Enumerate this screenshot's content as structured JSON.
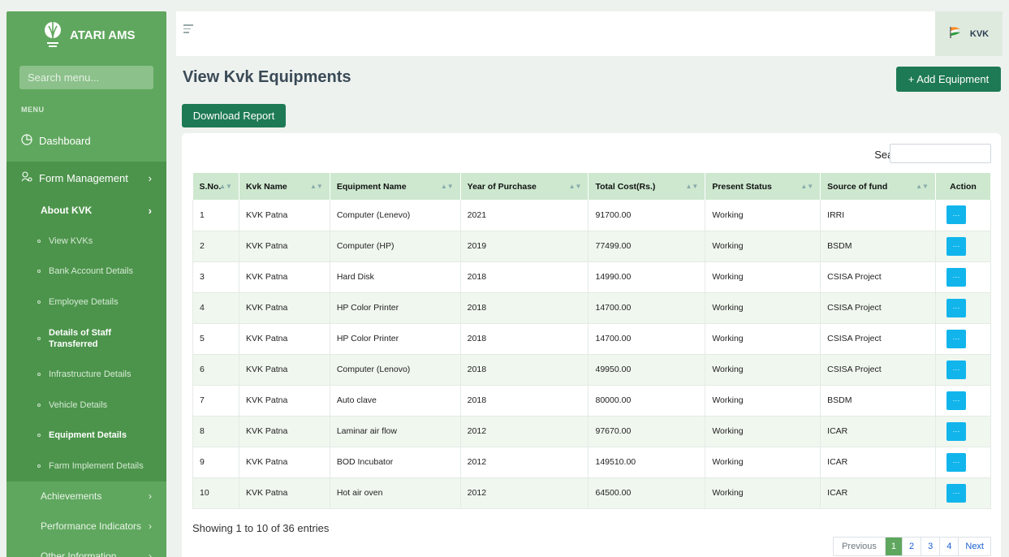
{
  "sidebar": {
    "brand": "ATARI AMS",
    "search_placeholder": "Search menu...",
    "menu_heading": "MENU",
    "dashboard": "Dashboard",
    "form_management": "Form Management",
    "about_kvk": "About KVK",
    "sub_items": [
      "View KVKs",
      "Bank Account Details",
      "Employee Details",
      "Details of Staff Transferred",
      "Infrastructure Details",
      "Vehicle Details",
      "Equipment Details",
      "Farm Implement Details"
    ],
    "achievements": "Achievements",
    "performance_indicators": "Performance Indicators",
    "other_information": "Other Information"
  },
  "topbar": {
    "user": "KVK"
  },
  "page": {
    "title": "View Kvk Equipments",
    "add_button": "+ Add Equipment",
    "download_button": "Download Report",
    "search_label": "Search:"
  },
  "table": {
    "columns": [
      "S.No.",
      "Kvk Name",
      "Equipment Name",
      "Year of Purchase",
      "Total Cost(Rs.)",
      "Present Status",
      "Source of fund",
      "Action"
    ],
    "rows": [
      [
        "1",
        "KVK Patna",
        "Computer (Lenevo)",
        "2021",
        "91700.00",
        "Working",
        "IRRI"
      ],
      [
        "2",
        "KVK Patna",
        "Computer (HP)",
        "2019",
        "77499.00",
        "Working",
        "BSDM"
      ],
      [
        "3",
        "KVK Patna",
        "Hard Disk",
        "2018",
        "14990.00",
        "Working",
        "CSISA Project"
      ],
      [
        "4",
        "KVK Patna",
        "HP Color Printer",
        "2018",
        "14700.00",
        "Working",
        "CSISA Project"
      ],
      [
        "5",
        "KVK Patna",
        "HP Color Printer",
        "2018",
        "14700.00",
        "Working",
        "CSISA Project"
      ],
      [
        "6",
        "KVK Patna",
        "Computer (Lenovo)",
        "2018",
        "49950.00",
        "Working",
        "CSISA Project"
      ],
      [
        "7",
        "KVK Patna",
        "Auto clave",
        "2018",
        "80000.00",
        "Working",
        "BSDM"
      ],
      [
        "8",
        "KVK Patna",
        "Laminar air flow",
        "2012",
        "97670.00",
        "Working",
        "ICAR"
      ],
      [
        "9",
        "KVK Patna",
        "BOD Incubator",
        "2012",
        "149510.00",
        "Working",
        "ICAR"
      ],
      [
        "10",
        "KVK Patna",
        "Hot air oven",
        "2012",
        "64500.00",
        "Working",
        "ICAR"
      ]
    ],
    "action_label": "···",
    "info": "Showing 1 to 10 of 36 entries"
  },
  "pagination": {
    "previous": "Previous",
    "pages": [
      "1",
      "2",
      "3",
      "4"
    ],
    "next": "Next"
  },
  "colors": {
    "sidebar": "#5fa75e",
    "primary_button": "#1e7a54",
    "header_row": "#cde8cf",
    "action_button": "#11b5ec"
  },
  "icons": [
    "emblem-logo-icon",
    "dashboard-pie-icon",
    "form-management-icon",
    "hamburger-icon",
    "india-flag-icon"
  ]
}
